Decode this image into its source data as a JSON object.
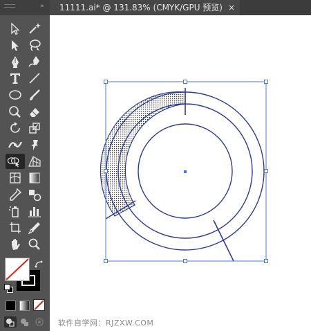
{
  "document_tab": {
    "title": "11111.ai* @ 131.83% (CMYK/GPU 预览)",
    "close_label": "×"
  },
  "toolbar": {
    "tools": [
      {
        "name": "selection-tool-icon"
      },
      {
        "name": "magic-wand-tool-icon"
      },
      {
        "name": "direct-selection-tool-icon"
      },
      {
        "name": "lasso-tool-icon"
      },
      {
        "name": "pen-tool-icon"
      },
      {
        "name": "curvature-tool-icon"
      },
      {
        "name": "type-tool-icon"
      },
      {
        "name": "line-segment-tool-icon"
      },
      {
        "name": "ellipse-tool-icon"
      },
      {
        "name": "paintbrush-tool-icon"
      },
      {
        "name": "shaper-tool-icon"
      },
      {
        "name": "eraser-tool-icon"
      },
      {
        "name": "rotate-tool-icon"
      },
      {
        "name": "scale-tool-icon"
      },
      {
        "name": "width-tool-icon"
      },
      {
        "name": "puppet-warp-tool-icon"
      },
      {
        "name": "shape-builder-tool-icon",
        "active": true
      },
      {
        "name": "perspective-grid-tool-icon"
      },
      {
        "name": "mesh-tool-icon"
      },
      {
        "name": "gradient-tool-icon"
      },
      {
        "name": "eyedropper-tool-icon"
      },
      {
        "name": "blend-tool-icon"
      },
      {
        "name": "symbol-sprayer-tool-icon"
      },
      {
        "name": "column-graph-tool-icon"
      },
      {
        "name": "artboard-tool-icon"
      },
      {
        "name": "slice-tool-icon"
      },
      {
        "name": "hand-tool-icon"
      },
      {
        "name": "zoom-tool-icon"
      }
    ],
    "fill_color": "#ffffff",
    "stroke_color": "#000000"
  },
  "colors": {
    "path_stroke": "#2b3a9a",
    "selection": "#4a78d8",
    "canvas_bg": "#ffffff"
  },
  "watermark": "软件自学网：RJZXW.COM"
}
